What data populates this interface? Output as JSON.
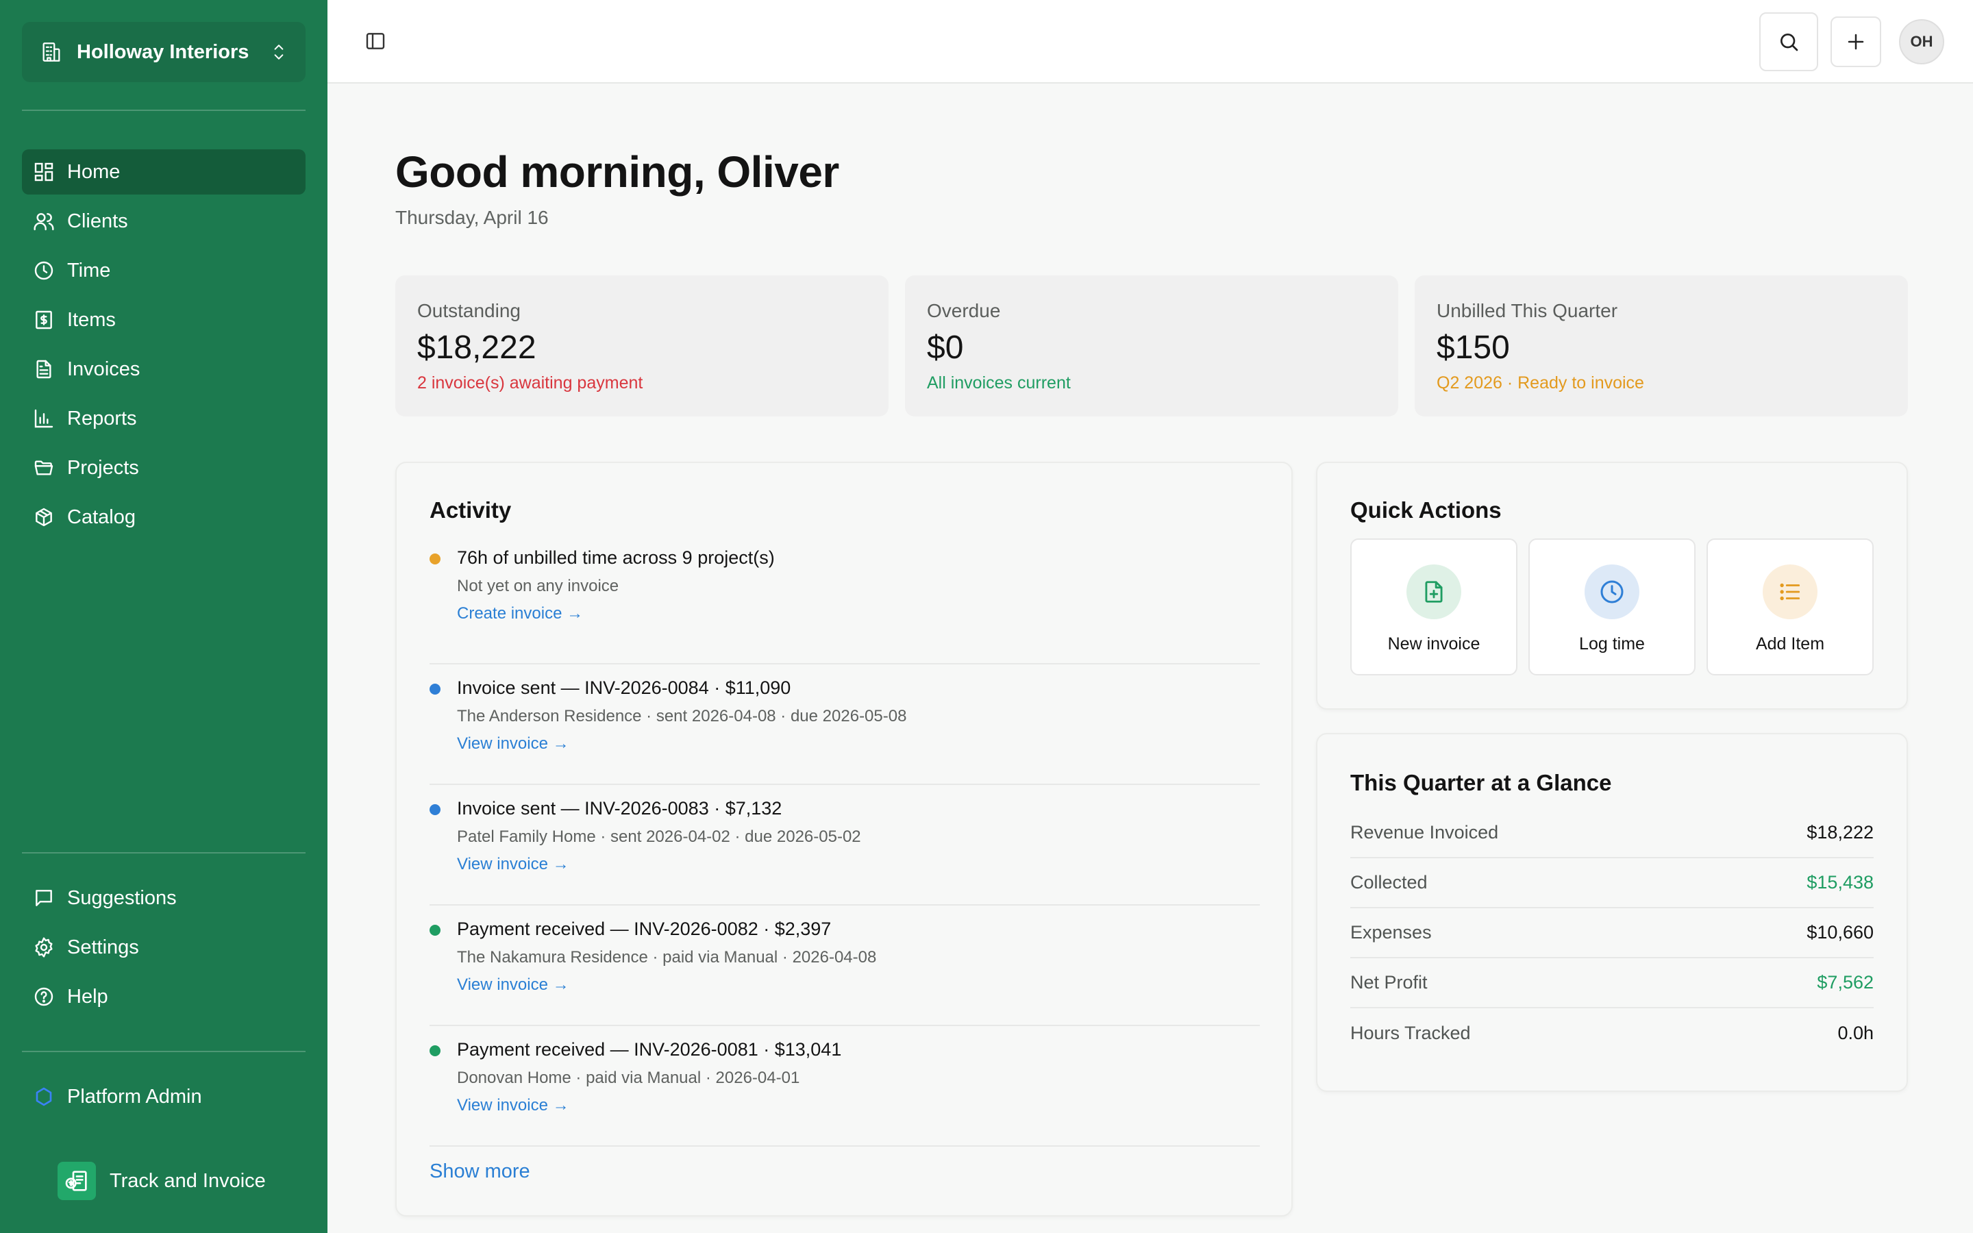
{
  "workspace": {
    "name": "Holloway Interiors"
  },
  "nav": {
    "primary": [
      {
        "label": "Home",
        "icon": "dashboard-icon"
      },
      {
        "label": "Clients",
        "icon": "users-icon"
      },
      {
        "label": "Time",
        "icon": "clock-icon"
      },
      {
        "label": "Items",
        "icon": "dollar-receipt-icon"
      },
      {
        "label": "Invoices",
        "icon": "document-icon"
      },
      {
        "label": "Reports",
        "icon": "bar-chart-icon"
      },
      {
        "label": "Projects",
        "icon": "folder-icon"
      },
      {
        "label": "Catalog",
        "icon": "package-icon"
      }
    ],
    "secondary": [
      {
        "label": "Suggestions",
        "icon": "message-icon"
      },
      {
        "label": "Settings",
        "icon": "gear-icon"
      },
      {
        "label": "Help",
        "icon": "help-circle-icon"
      }
    ],
    "admin": {
      "label": "Platform Admin",
      "icon": "hexagon-icon"
    },
    "active": "Home"
  },
  "brand": {
    "name": "Track and Invoice"
  },
  "topbar": {
    "avatar_initials": "OH"
  },
  "greeting": {
    "title": "Good morning, Oliver",
    "date": "Thursday, April 16"
  },
  "stats": [
    {
      "label": "Outstanding",
      "value": "$18,222",
      "sub": "2 invoice(s) awaiting payment",
      "sub_color": "#d9363e"
    },
    {
      "label": "Overdue",
      "value": "$0",
      "sub": "All invoices current",
      "sub_color": "#1f9d62"
    },
    {
      "label": "Unbilled This Quarter",
      "value": "$150",
      "sub": "Q2 2026 · Ready to invoice",
      "sub_color": "#e39a1e"
    }
  ],
  "activity": {
    "title": "Activity",
    "items": [
      {
        "title": "76h of unbilled time across 9 project(s)",
        "detail": "Not yet on any invoice",
        "link": "Create invoice →",
        "dot": "#e8a22a"
      },
      {
        "title": "Invoice sent — INV-2026-0084 · $11,090",
        "detail": "The Anderson Residence · sent 2026-04-08 · due 2026-05-08",
        "link": "View invoice →",
        "dot": "#2f7fd6"
      },
      {
        "title": "Invoice sent — INV-2026-0083 · $7,132",
        "detail": "Patel Family Home · sent 2026-04-02 · due 2026-05-02",
        "link": "View invoice →",
        "dot": "#2f7fd6"
      },
      {
        "title": "Payment received — INV-2026-0082 · $2,397",
        "detail": "The Nakamura Residence · paid via Manual · 2026-04-08",
        "link": "View invoice →",
        "dot": "#1f9d62"
      },
      {
        "title": "Payment received — INV-2026-0081 · $13,041",
        "detail": "Donovan Home · paid via Manual · 2026-04-01",
        "link": "View invoice →",
        "dot": "#1f9d62"
      }
    ],
    "show_more": "Show more"
  },
  "quick_actions": {
    "title": "Quick Actions",
    "items": [
      {
        "label": "New invoice",
        "icon": "file-plus-icon",
        "color": "#1f9d62",
        "bg": "#dff1e6"
      },
      {
        "label": "Log time",
        "icon": "clock-icon",
        "color": "#2f7fd6",
        "bg": "#dde9f7"
      },
      {
        "label": "Add Item",
        "icon": "list-icon",
        "color": "#e39a1e",
        "bg": "#fbeedb"
      }
    ]
  },
  "glance": {
    "title": "This Quarter at a Glance",
    "rows": [
      {
        "label": "Revenue Invoiced",
        "value": "$18,222",
        "color": "#141414"
      },
      {
        "label": "Collected",
        "value": "$15,438",
        "color": "#1f9d62"
      },
      {
        "label": "Expenses",
        "value": "$10,660",
        "color": "#141414"
      },
      {
        "label": "Net Profit",
        "value": "$7,562",
        "color": "#1f9d62"
      },
      {
        "label": "Hours Tracked",
        "value": "0.0h",
        "color": "#141414"
      }
    ]
  }
}
